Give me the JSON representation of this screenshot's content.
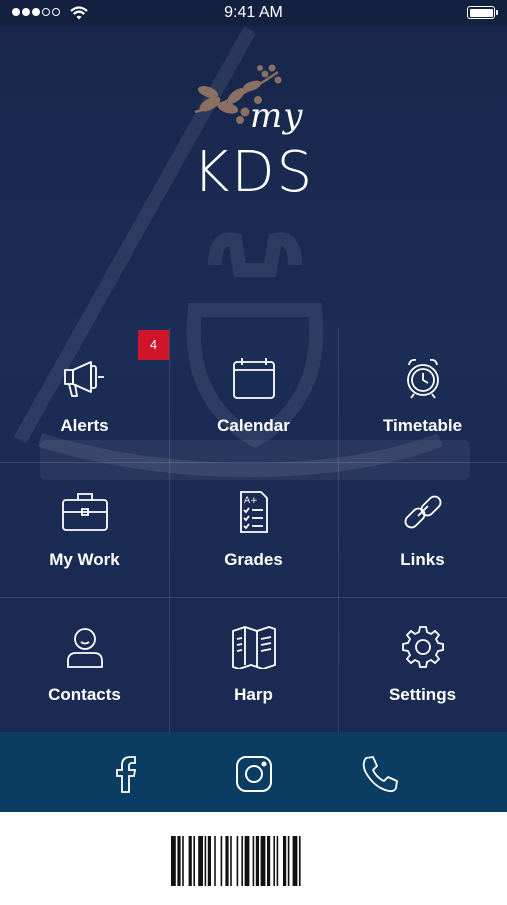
{
  "status_bar": {
    "time": "9:41 AM"
  },
  "logo": {
    "prefix": "my",
    "name": "KDS"
  },
  "badge": {
    "alerts_count": "4"
  },
  "tiles": [
    {
      "label": "Alerts",
      "icon": "megaphone-icon"
    },
    {
      "label": "Calendar",
      "icon": "calendar-icon"
    },
    {
      "label": "Timetable",
      "icon": "alarm-clock-icon"
    },
    {
      "label": "My Work",
      "icon": "briefcase-icon"
    },
    {
      "label": "Grades",
      "icon": "grade-sheet-icon"
    },
    {
      "label": "Links",
      "icon": "chain-link-icon"
    },
    {
      "label": "Contacts",
      "icon": "person-icon"
    },
    {
      "label": "Harp",
      "icon": "folded-map-icon"
    },
    {
      "label": "Settings",
      "icon": "gear-icon"
    }
  ],
  "social": [
    "facebook-icon",
    "instagram-icon",
    "phone-icon"
  ],
  "colors": {
    "background": "#1a2a52",
    "social_bar": "#0b3d62",
    "badge": "#d0142a",
    "logo_sprig": "#8a7064"
  }
}
